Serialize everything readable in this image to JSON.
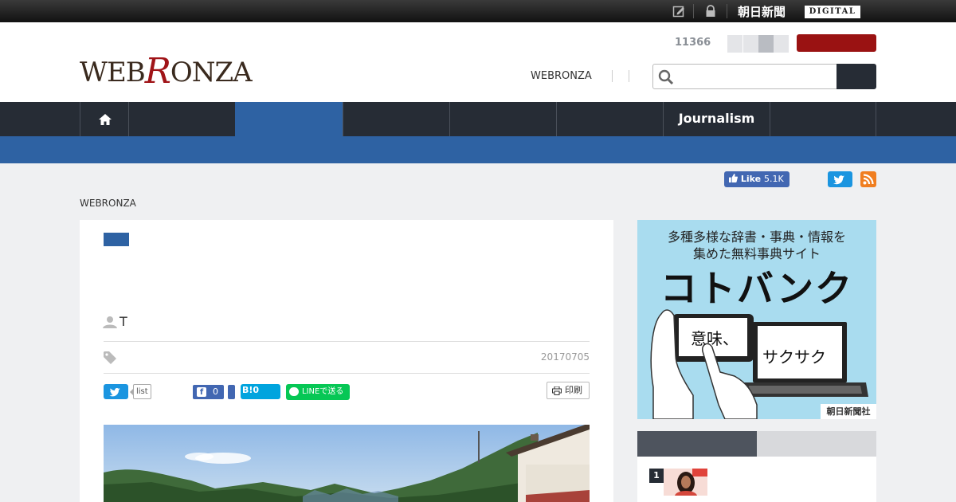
{
  "topbar": {
    "asahi_logo": "朝日新聞",
    "digital_label": "DIGITAL",
    "icons": [
      "edit-icon",
      "lock-icon"
    ]
  },
  "header": {
    "logo_pre": "WEB",
    "logo_r": "R",
    "logo_post": "ONZA",
    "count": "11366",
    "link": "WEBRONZA",
    "search_placeholder": ""
  },
  "nav": {
    "items": [
      {
        "label": "",
        "icon": "home-icon"
      },
      {
        "label": ""
      },
      {
        "label": "",
        "active": true
      },
      {
        "label": ""
      },
      {
        "label": ""
      },
      {
        "label": ""
      },
      {
        "label": "Journalism"
      },
      {
        "label": ""
      }
    ]
  },
  "social": {
    "fb_like_label": "Like",
    "fb_like_count": "5.1K"
  },
  "breadcrumb": "WEBRONZA",
  "article": {
    "author": "T",
    "date": "20170705",
    "share": {
      "list_label": "list",
      "fb_count": "0",
      "hatena_label": "B!",
      "hatena_count": "0",
      "line_label": "LINEで送る"
    },
    "print_label": "印刷"
  },
  "ad": {
    "line1": "多種多様な辞書・事典・情報を",
    "line2": "集めた無料事典サイト",
    "brand": "コトバンク",
    "phrase1": "意味、",
    "phrase2": "サクサク",
    "credit": "朝日新聞社"
  },
  "ranking": {
    "first_rank": "1"
  },
  "colors": {
    "accent_blue": "#2e62a3",
    "nav_dark": "#262c35",
    "brand_red": "#9a1212"
  }
}
